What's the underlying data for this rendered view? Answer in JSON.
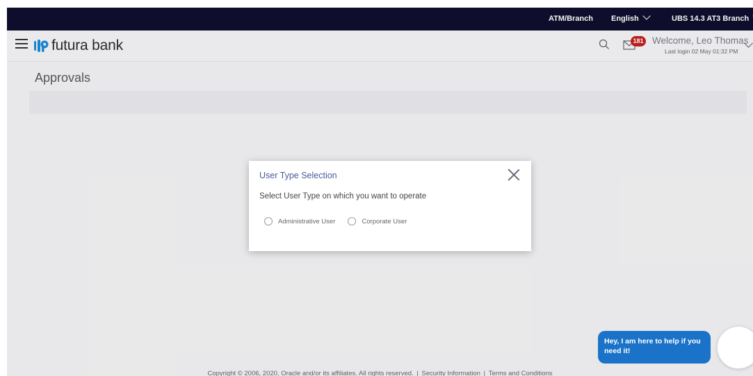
{
  "topbar": {
    "atm_branch": "ATM/Branch",
    "language": "English",
    "branch": "UBS 14.3 AT3 Branch"
  },
  "header": {
    "logo_text": "futura bank",
    "notification_count": "181",
    "welcome": "Welcome, Leo Thomas",
    "last_login": "Last login 02 May 01:32 PM"
  },
  "page": {
    "title": "Approvals"
  },
  "modal": {
    "title": "User Type Selection",
    "subtitle": "Select User Type on which you want to operate",
    "options": [
      "Administrative User",
      "Corporate User"
    ]
  },
  "footer": {
    "copyright": "Copyright © 2006, 2020, Oracle and/or its affiliates. All rights reserved.",
    "separator": "|",
    "security": "Security Information",
    "terms": "Terms and Conditions"
  },
  "chat": {
    "message": "Hey, I am here to help if you need it!"
  },
  "colors": {
    "topbar_bg": "#0f0f2e",
    "modal_title": "#4a5a9a",
    "badge": "#c41f1f",
    "chat_bubble": "#1a73c9"
  },
  "icons": [
    "hamburger-menu-icon",
    "futura-bank-logo-icon",
    "search-icon",
    "mail-icon",
    "close-icon",
    "chevron-down-icon"
  ]
}
